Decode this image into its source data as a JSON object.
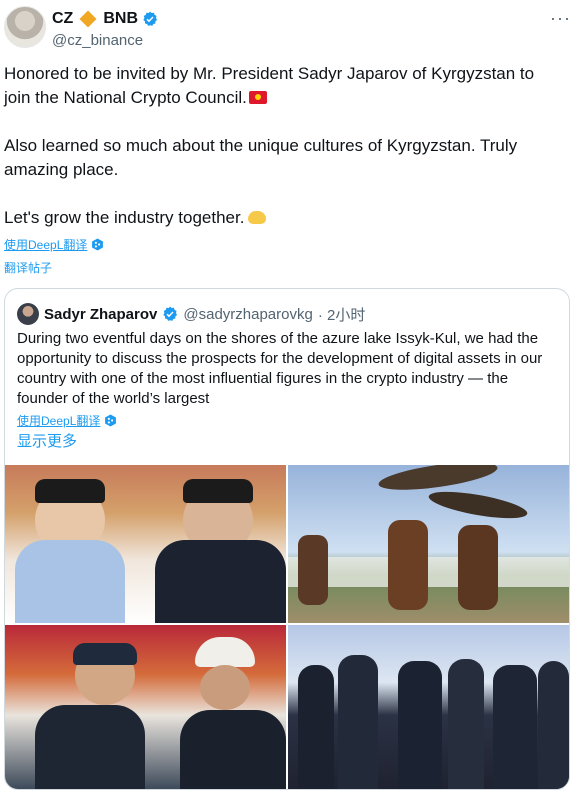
{
  "author": {
    "name": "CZ",
    "badge": "BNB",
    "handle": "@cz_binance",
    "more_label": "···"
  },
  "tweet": {
    "line1": "Honored to be invited by Mr. President Sadyr Japarov of Kyrgyzstan to join the National Crypto Council.",
    "line2": "Also learned so much about the unique cultures of Kyrgyzstan. Truly amazing place.",
    "line3": "Let's grow the industry together."
  },
  "translation": {
    "deepl_label": "使用DeepL翻译",
    "translate_label": "翻译帖子"
  },
  "quote": {
    "name": "Sadyr Zhaparov",
    "handle": "@sadyrzhaparovkg",
    "time": "· 2小时",
    "text": "During two eventful days on the shores of the azure lake Issyk-Kul, we had the opportunity to discuss the prospects for the development of digital assets in our country with one of the most influential figures in the crypto industry — the founder of the world’s largest",
    "deepl_label": "使用DeepL翻译",
    "show_more": "显示更多"
  },
  "colors": {
    "link": "#1d9bf0",
    "secondary_text": "#536471",
    "verified": "#1d9bf0",
    "border": "#cfd9de"
  },
  "icons": [
    "verified-badge-icon",
    "bnb-diamond-icon",
    "more-options-icon",
    "kyrgyzstan-flag-icon",
    "handshake-icon",
    "deepl-icon"
  ]
}
